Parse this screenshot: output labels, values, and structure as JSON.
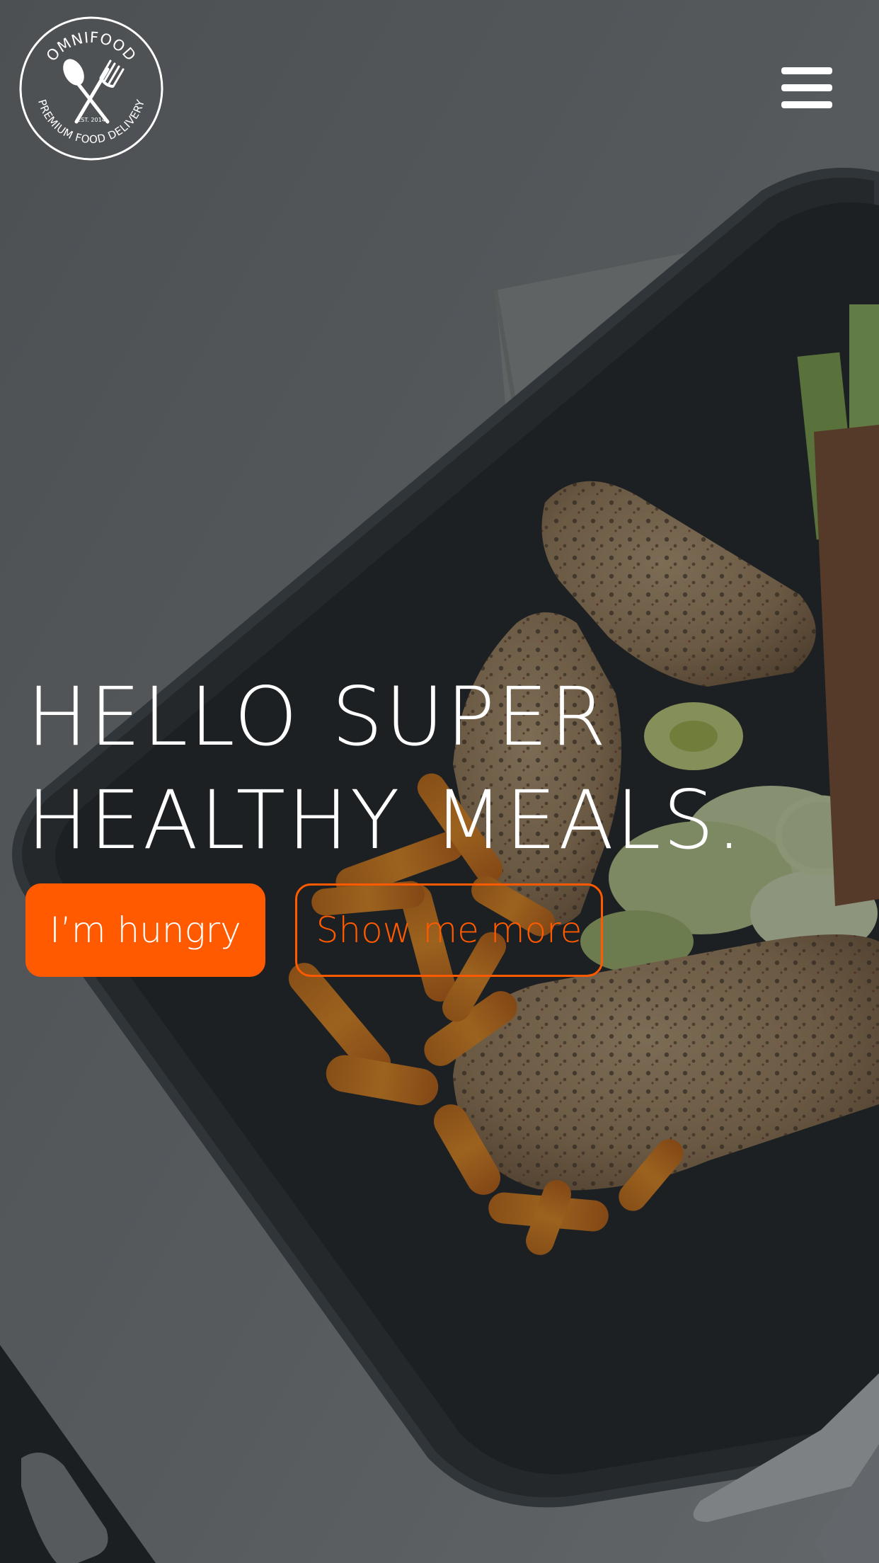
{
  "header": {
    "logo": {
      "brand": "OMNIFOOD",
      "est": "EST. 2014",
      "tagline": "PREMIUM FOOD DELIVERY",
      "icon": "spoon-fork-icon"
    },
    "menu_icon": "hamburger-menu-icon"
  },
  "hero": {
    "title_line1": "HELLO SUPER",
    "title_line2": "HEALTHY MEALS.",
    "primary_button": "I’m hungry",
    "secondary_button": "Show me more"
  },
  "colors": {
    "accent": "#ff5a00",
    "text": "#ffffff",
    "overlay": "#3c4044"
  }
}
